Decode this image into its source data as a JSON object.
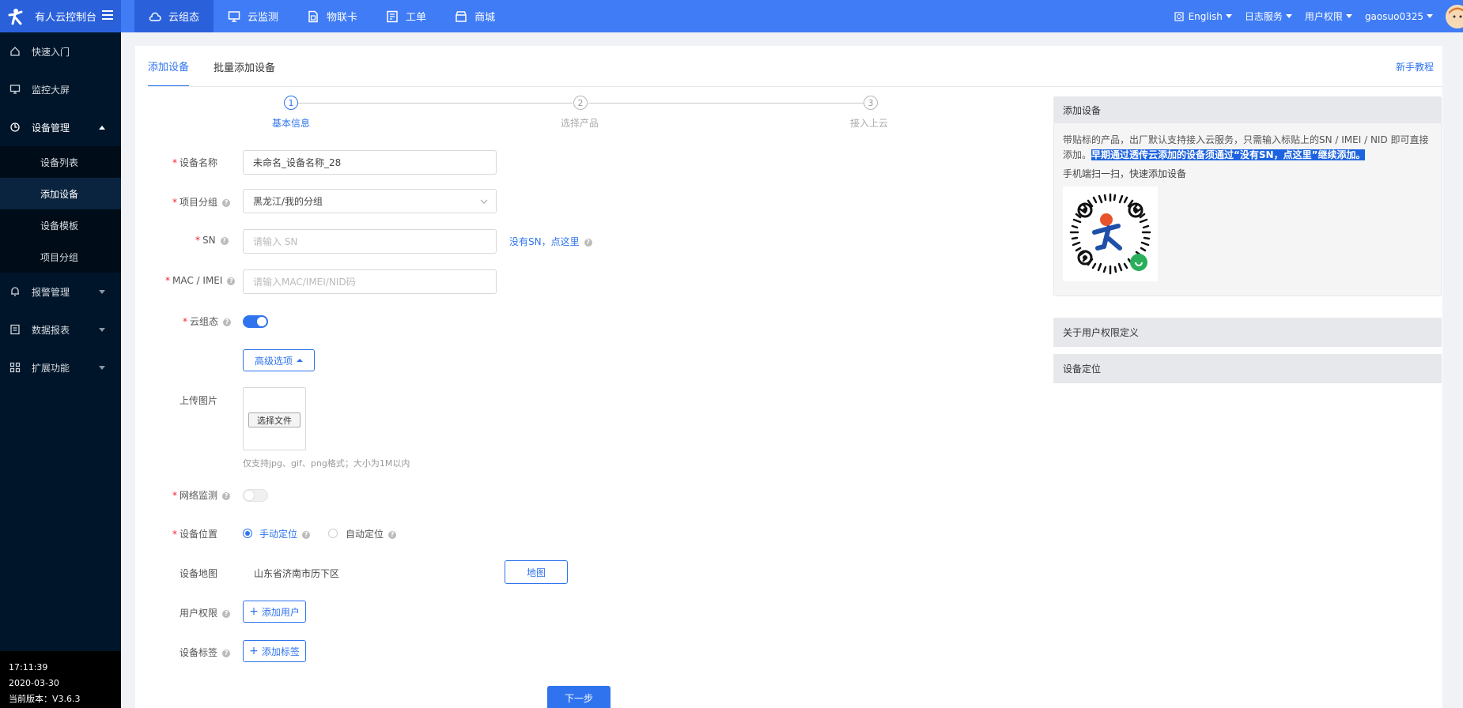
{
  "brand": {
    "name": "有人云控制台"
  },
  "topnav": [
    {
      "label": "云组态",
      "icon": "cloud-icon",
      "active": true
    },
    {
      "label": "云监测",
      "icon": "monitor-icon"
    },
    {
      "label": "物联卡",
      "icon": "sim-card-icon"
    },
    {
      "label": "工单",
      "icon": "ticket-icon"
    },
    {
      "label": "商城",
      "icon": "store-icon"
    }
  ],
  "topright": {
    "language": "English",
    "log": "日志服务",
    "perm": "用户权限",
    "user": "gaosuo0325"
  },
  "sidebar": {
    "items": [
      {
        "label": "快速入门",
        "icon": "home-icon"
      },
      {
        "label": "监控大屏",
        "icon": "screen-icon"
      },
      {
        "label": "设备管理",
        "icon": "device-icon"
      },
      {
        "label": "报警管理",
        "icon": "bell-icon"
      },
      {
        "label": "数据报表",
        "icon": "report-icon"
      },
      {
        "label": "扩展功能",
        "icon": "apps-icon"
      }
    ],
    "sub": [
      "设备列表",
      "添加设备",
      "设备模板",
      "项目分组"
    ],
    "footer": {
      "time": "17:11:39",
      "date": "2020-03-30",
      "version": "当前版本：V3.6.3"
    }
  },
  "tabs": [
    "添加设备",
    "批量添加设备"
  ],
  "tutorial": "新手教程",
  "steps": [
    {
      "num": "1",
      "label": "基本信息"
    },
    {
      "num": "2",
      "label": "选择产品"
    },
    {
      "num": "3",
      "label": "接入上云"
    }
  ],
  "form": {
    "device_name_label": "设备名称",
    "device_name_value": "未命名_设备名称_28",
    "group_label": "项目分组",
    "group_value": "黑龙江/我的分组",
    "sn_label": "SN",
    "sn_placeholder": "请输入 SN",
    "no_sn_link": "没有SN，点这里",
    "mac_label": "MAC / IMEI",
    "mac_placeholder": "请输入MAC/IMEI/NID码",
    "cloud_label": "云组态",
    "advanced": "高级选项",
    "upload_label": "上传图片",
    "choose_file": "选择文件",
    "upload_hint": "仅支持jpg、gif、png格式；大小为1M以内",
    "net_label": "网络监测",
    "location_label": "设备位置",
    "manual": "手动定位",
    "auto": "自动定位",
    "map_label": "设备地图",
    "map_value": "山东省济南市历下区",
    "map_button": "地图",
    "user_label": "用户权限",
    "add_user": "添加用户",
    "tag_label": "设备标签",
    "add_tag": "添加标签",
    "next": "下一步"
  },
  "panel": {
    "title": "添加设备",
    "text1": "带贴标的产品，出厂默认支持接入云服务，只需输入标贴上的SN / IMEI / NID 即可直接添加。",
    "highlight": "早期通过透传云添加的设备须通过“没有SN，点这里”继续添加。",
    "scan": "手机端扫一扫，快速添加设备",
    "collapse1": "关于用户权限定义",
    "collapse2": "设备定位"
  },
  "colors": {
    "primary": "#2f74ee",
    "topbar": "#3f7cf5",
    "sidebar": "#001529",
    "highlight": "#1d63e0"
  }
}
